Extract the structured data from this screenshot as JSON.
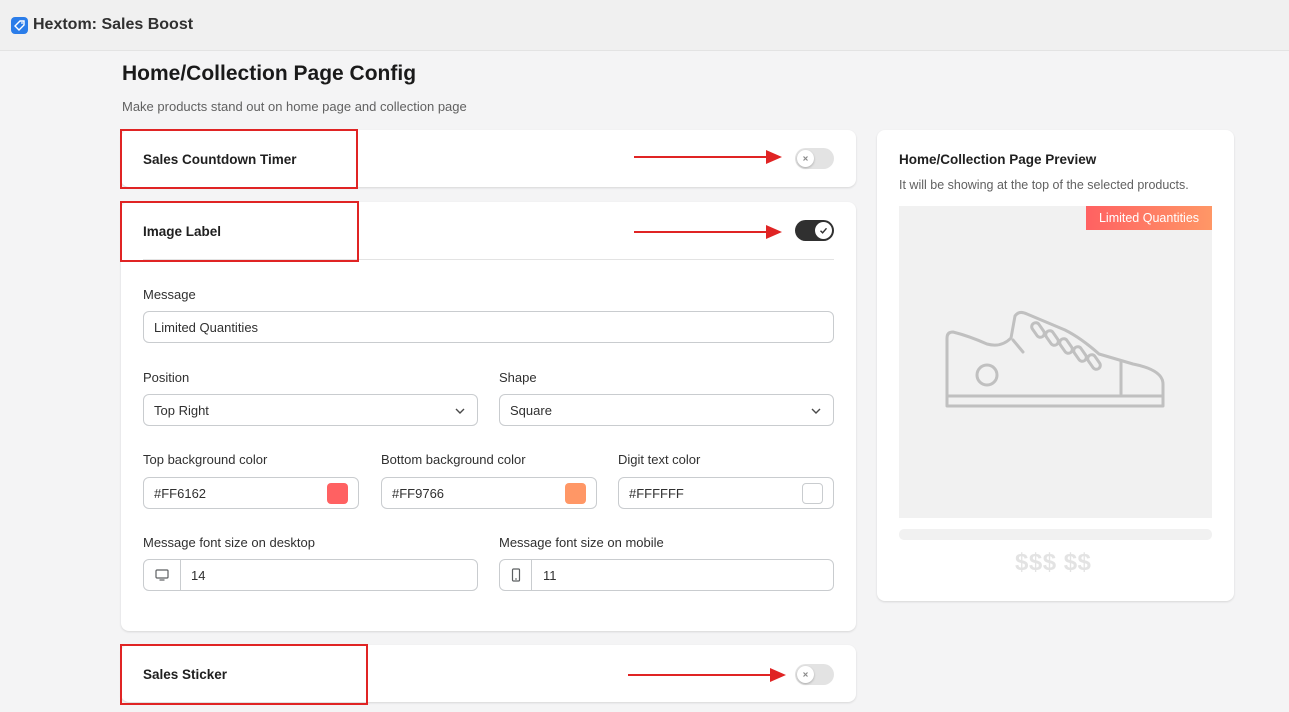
{
  "app": {
    "title": "Hextom: Sales Boost",
    "icon": "tag-icon"
  },
  "page": {
    "title": "Home/Collection Page Config",
    "subtitle": "Make products stand out on home page and collection page"
  },
  "sections": {
    "countdown": {
      "title": "Sales Countdown Timer",
      "enabled": false
    },
    "image_label": {
      "title": "Image Label",
      "enabled": true
    },
    "sticker": {
      "title": "Sales Sticker",
      "enabled": false
    }
  },
  "form": {
    "message": {
      "label": "Message",
      "value": "Limited Quantities"
    },
    "position": {
      "label": "Position",
      "value": "Top Right"
    },
    "shape": {
      "label": "Shape",
      "value": "Square"
    },
    "top_bg": {
      "label": "Top background color",
      "value": "#FF6162",
      "swatch": "#FF6162"
    },
    "bottom_bg": {
      "label": "Bottom background color",
      "value": "#FF9766",
      "swatch": "#FF9766"
    },
    "digit_text": {
      "label": "Digit text color",
      "value": "#FFFFFF",
      "swatch": "#FFFFFF"
    },
    "font_desktop": {
      "label": "Message font size on desktop",
      "value": "14",
      "icon": "desktop-icon"
    },
    "font_mobile": {
      "label": "Message font size on mobile",
      "value": "11",
      "icon": "mobile-icon"
    }
  },
  "preview": {
    "title": "Home/Collection Page Preview",
    "subtitle": "It will be showing at the top of the selected products.",
    "badge": "Limited Quantities",
    "price": "$$$ $$",
    "image": "sneaker-icon"
  },
  "colors": {
    "accent_dark": "#303030",
    "annotation_red": "#e02424"
  }
}
